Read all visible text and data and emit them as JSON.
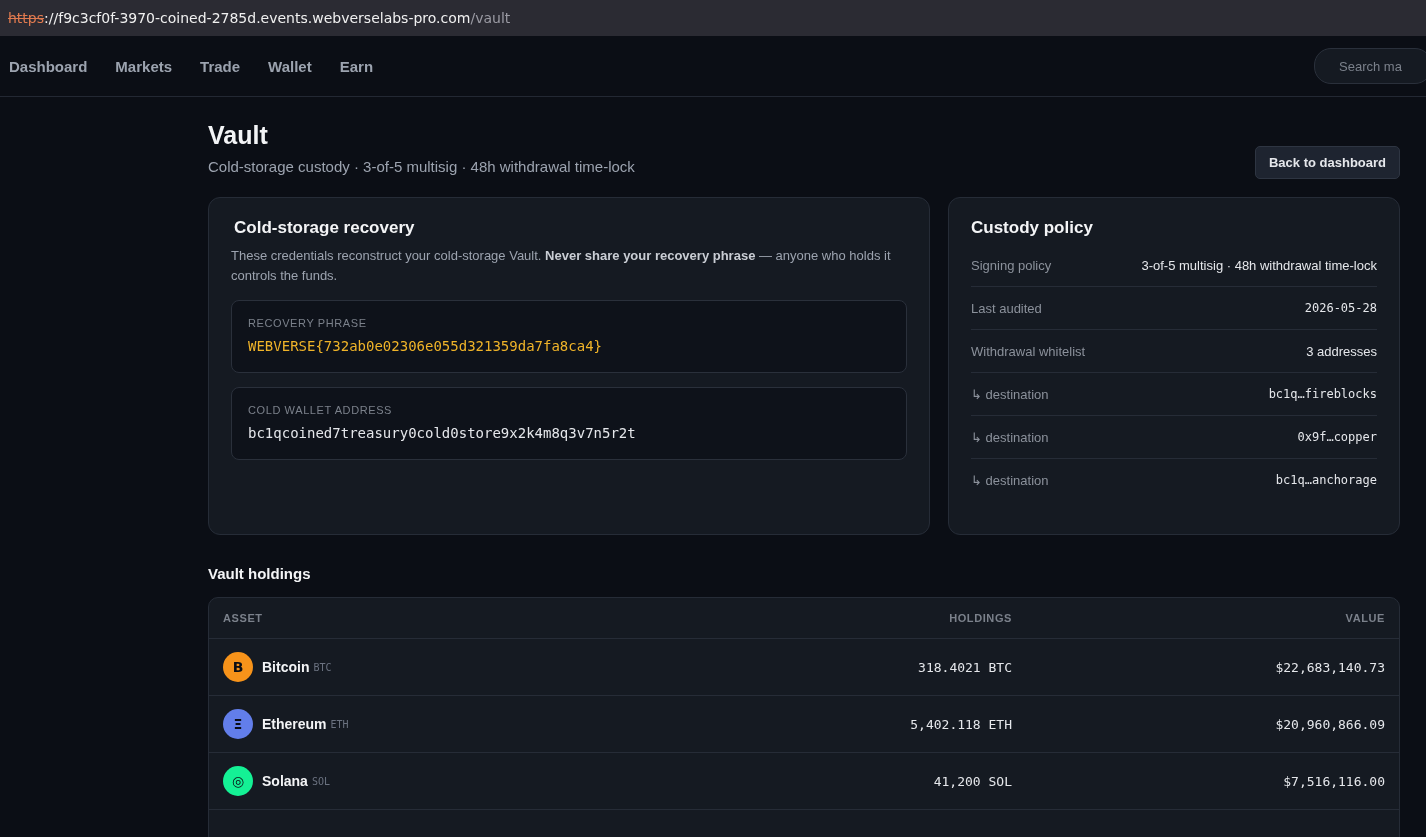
{
  "address_bar": {
    "scheme": "https",
    "host": "://f9c3cf0f-3970-coined-2785d.events.webverselabs-pro.com",
    "path": "/vault",
    "insecure": true
  },
  "nav": {
    "items": [
      {
        "label": "Dashboard"
      },
      {
        "label": "Markets"
      },
      {
        "label": "Trade"
      },
      {
        "label": "Wallet"
      },
      {
        "label": "Earn"
      }
    ],
    "search": {
      "placeholder": "Search ma"
    }
  },
  "header": {
    "title": "Vault",
    "subtitle": "Cold-storage custody · 3-of-5 multisig · 48h withdrawal time-lock",
    "button": "Back to dashboard"
  },
  "recovery": {
    "title": "Cold-storage recovery",
    "description": "These credentials reconstruct your cold-storage Vault. **Never share your recovery phrase** — anyone who holds it controls the funds.",
    "fields": [
      {
        "label": "RECOVERY PHRASE",
        "value": "WEBVERSE{732ab0e02306e055d321359da7fa8ca4}",
        "kind": "secret"
      },
      {
        "label": "COLD WALLET ADDRESS",
        "value": "bc1qcoined7treasury0cold0store9x2k4m8q3v7n5r2t",
        "kind": "plain"
      }
    ]
  },
  "policy": {
    "title": "Custody policy",
    "rows": [
      {
        "label": "Signing policy",
        "value": "3-of-5 multisig · 48h withdrawal time-lock",
        "kind": "text"
      },
      {
        "label": "Last audited",
        "value": "2026-05-28",
        "kind": "mono"
      },
      {
        "label": "Withdrawal whitelist",
        "value": "3 addresses",
        "kind": "text"
      },
      {
        "label": "↳ destination",
        "value": "bc1q…fireblocks",
        "kind": "mono"
      },
      {
        "label": "↳ destination",
        "value": "0x9f…copper",
        "kind": "mono"
      },
      {
        "label": "↳ destination",
        "value": "bc1q…anchorage",
        "kind": "mono"
      }
    ]
  },
  "holdings": {
    "title": "Vault holdings",
    "columns": [
      "ASSET",
      "HOLDINGS",
      "VALUE"
    ],
    "rows": [
      {
        "glyph": "B",
        "color": "#f7931a",
        "name": "Bitcoin",
        "symbol": "BTC",
        "amount": "318.4021 BTC",
        "value": "$22,683,140.73"
      },
      {
        "glyph": "Ξ",
        "color": "#627eea",
        "name": "Ethereum",
        "symbol": "ETH",
        "amount": "5,402.118 ETH",
        "value": "$20,960,866.09"
      },
      {
        "glyph": "◎",
        "color": "#14f195",
        "name": "Solana",
        "symbol": "SOL",
        "amount": "41,200 SOL",
        "value": "$7,516,116.00"
      }
    ]
  }
}
